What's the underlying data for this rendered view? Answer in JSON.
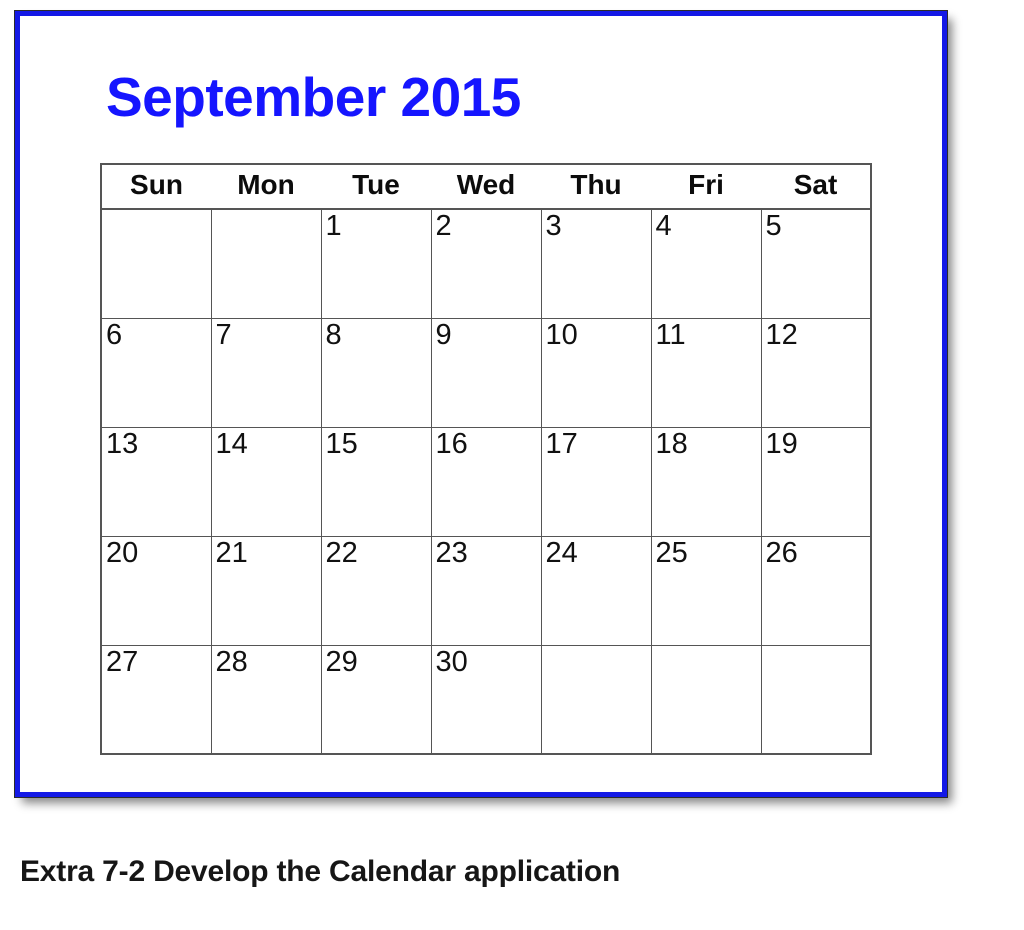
{
  "window": {
    "border_color": "#1419e6",
    "background": "#ffffff"
  },
  "calendar": {
    "title": "September 2015",
    "title_color": "#1515ff",
    "month": "September",
    "year": "2015",
    "weekday_headers": [
      "Sun",
      "Mon",
      "Tue",
      "Wed",
      "Thu",
      "Fri",
      "Sat"
    ],
    "weeks": [
      [
        "",
        "",
        "1",
        "2",
        "3",
        "4",
        "5"
      ],
      [
        "6",
        "7",
        "8",
        "9",
        "10",
        "11",
        "12"
      ],
      [
        "13",
        "14",
        "15",
        "16",
        "17",
        "18",
        "19"
      ],
      [
        "20",
        "21",
        "22",
        "23",
        "24",
        "25",
        "26"
      ],
      [
        "27",
        "28",
        "29",
        "30",
        "",
        "",
        ""
      ]
    ]
  },
  "caption": {
    "text": "Extra 7-2 Develop the Calendar application"
  }
}
